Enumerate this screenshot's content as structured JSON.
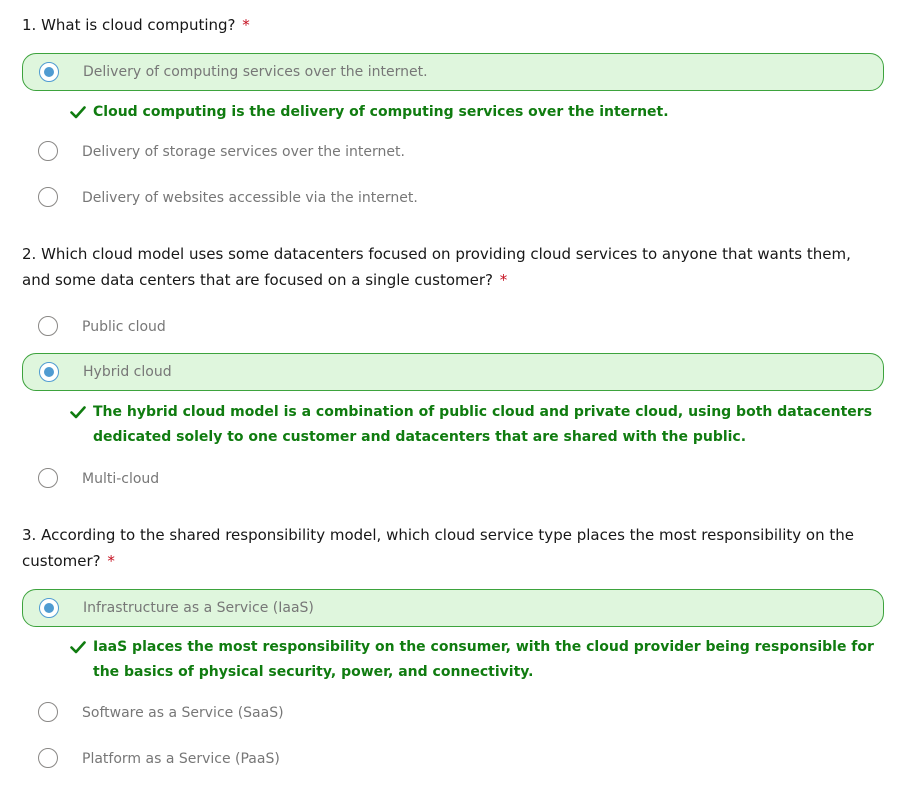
{
  "questions": [
    {
      "title": "1. What is cloud computing?",
      "required_marker": "*",
      "options": [
        {
          "label": "Delivery of computing services over the internet.",
          "selected": true
        },
        {
          "label": "Delivery of storage services over the internet.",
          "selected": false
        },
        {
          "label": "Delivery of websites accessible via the internet.",
          "selected": false
        }
      ],
      "feedback": "Cloud computing is the delivery of computing services over the internet."
    },
    {
      "title": "2. Which cloud model uses some datacenters focused on providing cloud services to anyone that wants them, and some data centers that are focused on a single customer?",
      "required_marker": "*",
      "options": [
        {
          "label": "Public cloud",
          "selected": false
        },
        {
          "label": "Hybrid cloud",
          "selected": true
        },
        {
          "label": "Multi-cloud",
          "selected": false
        }
      ],
      "feedback": "The hybrid cloud model is a combination of public cloud and private cloud, using both datacenters dedicated solely to one customer and datacenters that are shared with the public."
    },
    {
      "title": "3. According to the shared responsibility model, which cloud service type places the most responsibility on the customer?",
      "required_marker": "*",
      "options": [
        {
          "label": "Infrastructure as a Service (IaaS)",
          "selected": true
        },
        {
          "label": "Software as a Service (SaaS)",
          "selected": false
        },
        {
          "label": "Platform as a Service (PaaS)",
          "selected": false
        }
      ],
      "feedback": "IaaS places the most responsibility on the consumer, with the cloud provider being responsible for the basics of physical security, power, and connectivity."
    }
  ],
  "icons": {
    "feedback": "checkmark-icon"
  },
  "colors": {
    "correct_background": "#dff6dd",
    "correct_border": "#3da33d",
    "correct_text": "#107c10",
    "radio_selected": "#4f9bd1",
    "required_marker": "#c50f1f",
    "option_text": "#777777"
  }
}
